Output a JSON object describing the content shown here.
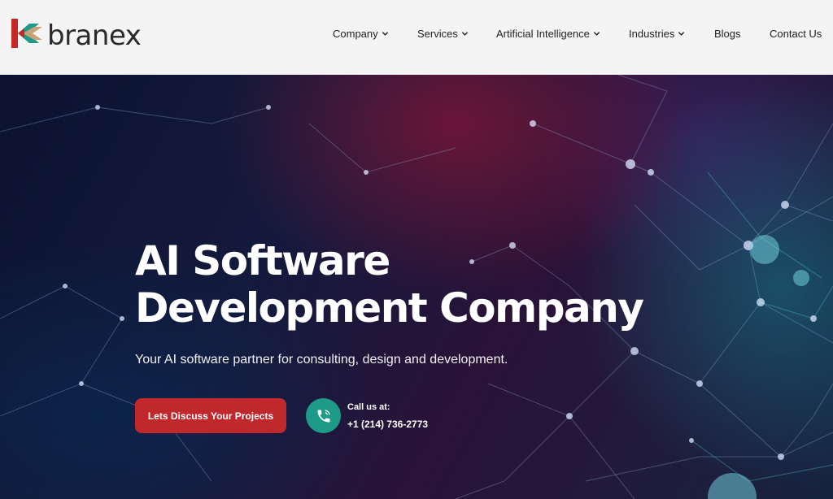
{
  "brand": {
    "name": "branex"
  },
  "nav": {
    "items": [
      {
        "label": "Company",
        "dropdown": true
      },
      {
        "label": "Services",
        "dropdown": true
      },
      {
        "label": "Artificial Intelligence",
        "dropdown": true
      },
      {
        "label": "Industries",
        "dropdown": true
      },
      {
        "label": "Blogs",
        "dropdown": false
      },
      {
        "label": "Contact Us",
        "dropdown": false
      }
    ]
  },
  "hero": {
    "title_line1": "AI Software",
    "title_line2": "Development Company",
    "subtitle": "Your AI software partner for consulting, design and development.",
    "cta_label": "Lets Discuss Your Projects",
    "call_label": "Call us at:",
    "call_phone": "+1 (214) 736-2773"
  },
  "colors": {
    "cta": "#c0282c",
    "call_icon": "#1e9a88",
    "logo_red": "#c62828",
    "logo_teal": "#1e9a88",
    "logo_tan": "#c9a27a"
  },
  "icons": [
    "logo-mark",
    "chevron-down-icon",
    "phone-icon"
  ]
}
